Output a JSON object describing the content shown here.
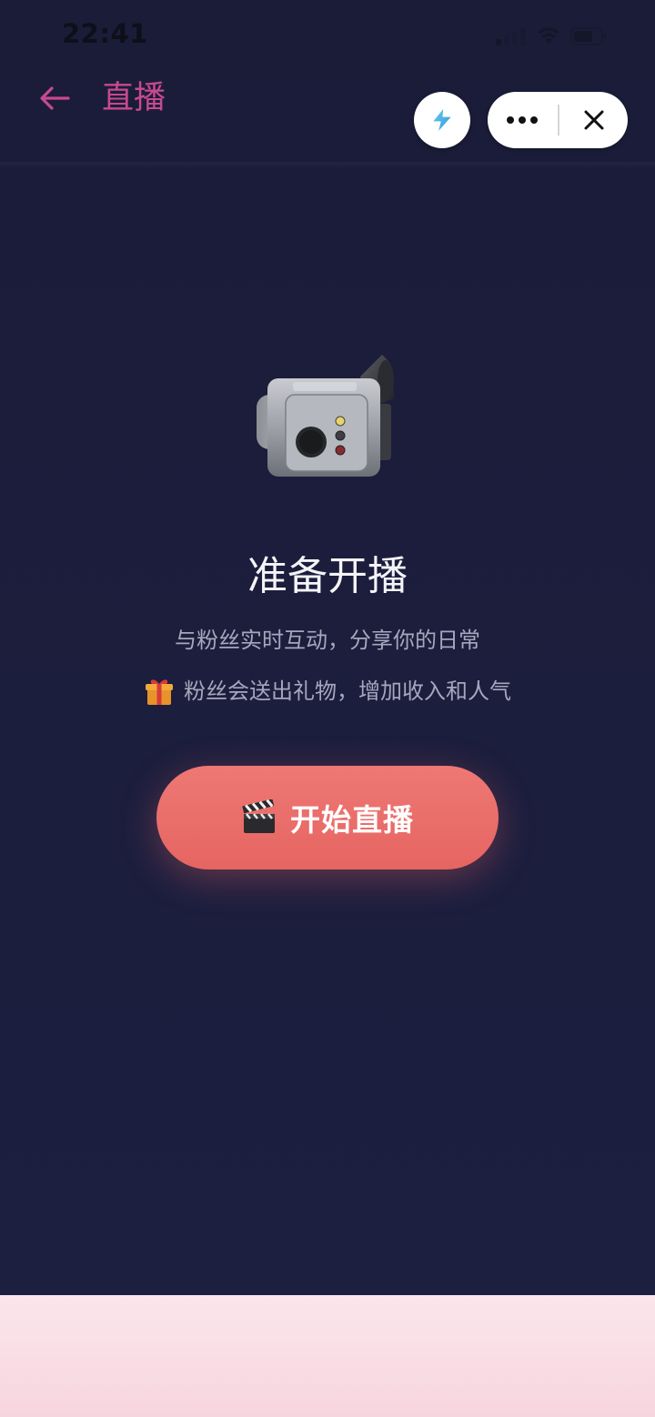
{
  "status_bar": {
    "time": "22:41"
  },
  "header": {
    "title": "直播",
    "back_icon": "arrow-left-icon",
    "boost_icon": "lightning-icon",
    "more_icon": "more-dots-icon",
    "close_icon": "close-icon"
  },
  "main": {
    "hero_icon": "video-camera-icon",
    "heading": "准备开播",
    "subtitle": "与粉丝实时互动，分享你的日常",
    "gift_icon": "gift-icon",
    "gift_text": "粉丝会送出礼物，增加收入和人气",
    "start_button": {
      "icon": "clapperboard-icon",
      "label": "开始直播"
    }
  },
  "colors": {
    "background": "#1b1c38",
    "accent_pink": "#c74a8e",
    "button_coral": "#ec7370",
    "bottom_panel": "#f9dde5"
  }
}
